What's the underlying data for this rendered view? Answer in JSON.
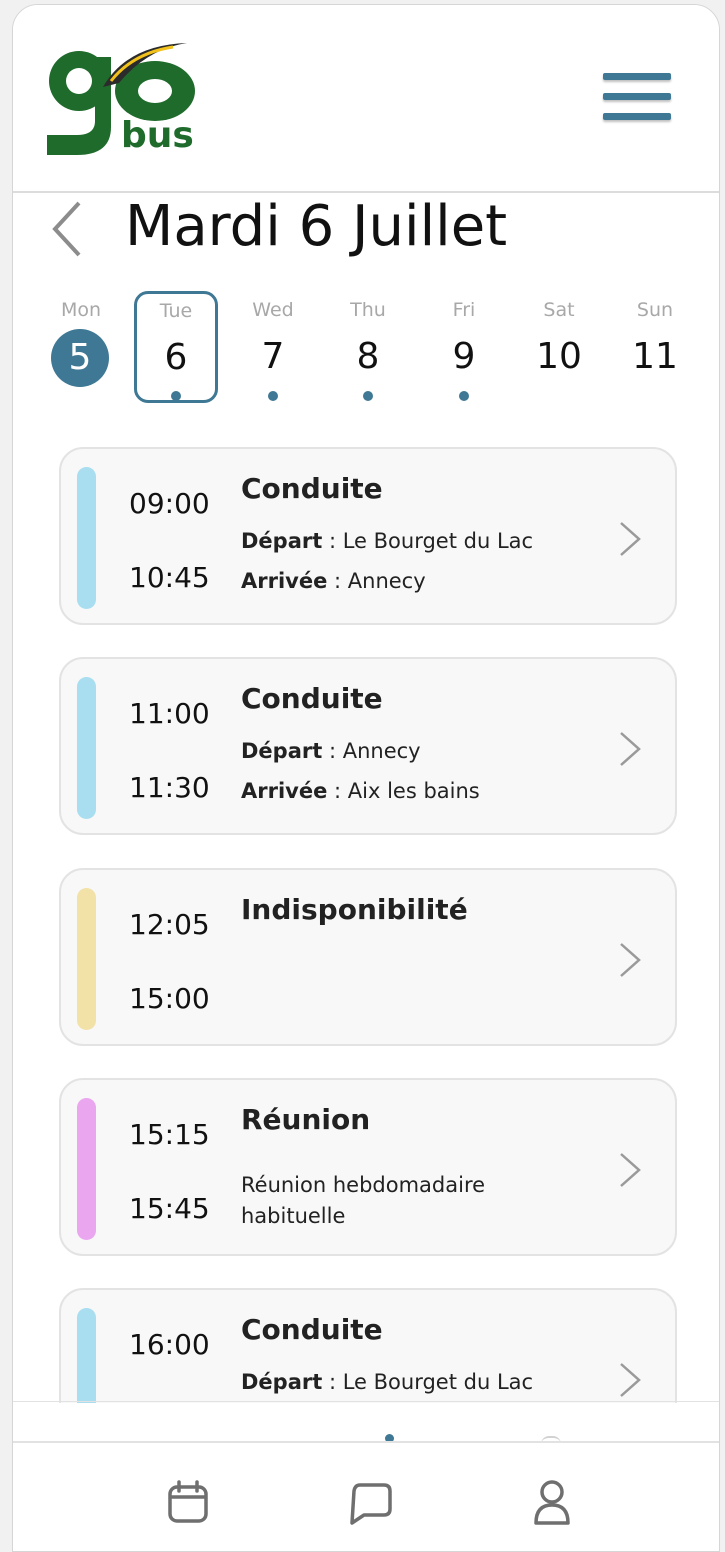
{
  "app": {
    "logo_text": "go bus",
    "accent_color": "#3f7894"
  },
  "header": {
    "title": "Mardi 6 Juillet"
  },
  "week": [
    {
      "name": "Mon",
      "num": "5",
      "state": "today",
      "has_event": false
    },
    {
      "name": "Tue",
      "num": "6",
      "state": "selected",
      "has_event": true
    },
    {
      "name": "Wed",
      "num": "7",
      "state": "normal",
      "has_event": true
    },
    {
      "name": "Thu",
      "num": "8",
      "state": "normal",
      "has_event": true
    },
    {
      "name": "Fri",
      "num": "9",
      "state": "normal",
      "has_event": true
    },
    {
      "name": "Sat",
      "num": "10",
      "state": "normal",
      "has_event": false
    },
    {
      "name": "Sun",
      "num": "11",
      "state": "normal",
      "has_event": false
    }
  ],
  "events": [
    {
      "start": "09:00",
      "end": "10:45",
      "title": "Conduite",
      "type_color": "#a8def0",
      "depart_label": "Départ",
      "depart": "Le Bourget du Lac",
      "arrivee_label": "Arrivée",
      "arrivee": "Annecy"
    },
    {
      "start": "11:00",
      "end": "11:30",
      "title": "Conduite",
      "type_color": "#a8def0",
      "depart_label": "Départ",
      "depart": "Annecy",
      "arrivee_label": "Arrivée",
      "arrivee": "Aix les bains"
    },
    {
      "start": "12:05",
      "end": "15:00",
      "title": "Indisponibilité",
      "type_color": "#f2e2a8"
    },
    {
      "start": "15:15",
      "end": "15:45",
      "title": "Réunion",
      "type_color": "#eaa6ef",
      "description": "Réunion hebdomadaire habituelle"
    },
    {
      "start": "16:00",
      "end": "",
      "title": "Conduite",
      "type_color": "#a8def0",
      "depart_label": "Départ",
      "depart": "Le Bourget du Lac"
    }
  ],
  "nav": {
    "items": [
      "calendar-icon",
      "message-icon",
      "user-icon"
    ]
  }
}
